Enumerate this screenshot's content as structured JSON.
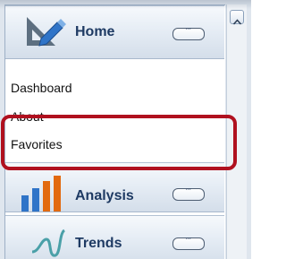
{
  "nav": {
    "groups": [
      {
        "label": "Home",
        "icon": "drafting-pencil-icon"
      },
      {
        "label": "Analysis",
        "icon": "bar-chart-icon"
      },
      {
        "label": "Trends",
        "icon": "trend-curve-icon"
      }
    ],
    "home_items": [
      {
        "label": "Dashboard"
      },
      {
        "label": "About"
      },
      {
        "label": "Favorites"
      }
    ],
    "more_button_label": "′′′"
  },
  "colors": {
    "highlight": "#b0111f",
    "header_text": "#1e3a63",
    "analysis_bar_blue": "#2f74c8",
    "analysis_bar_orange": "#e26a10"
  }
}
